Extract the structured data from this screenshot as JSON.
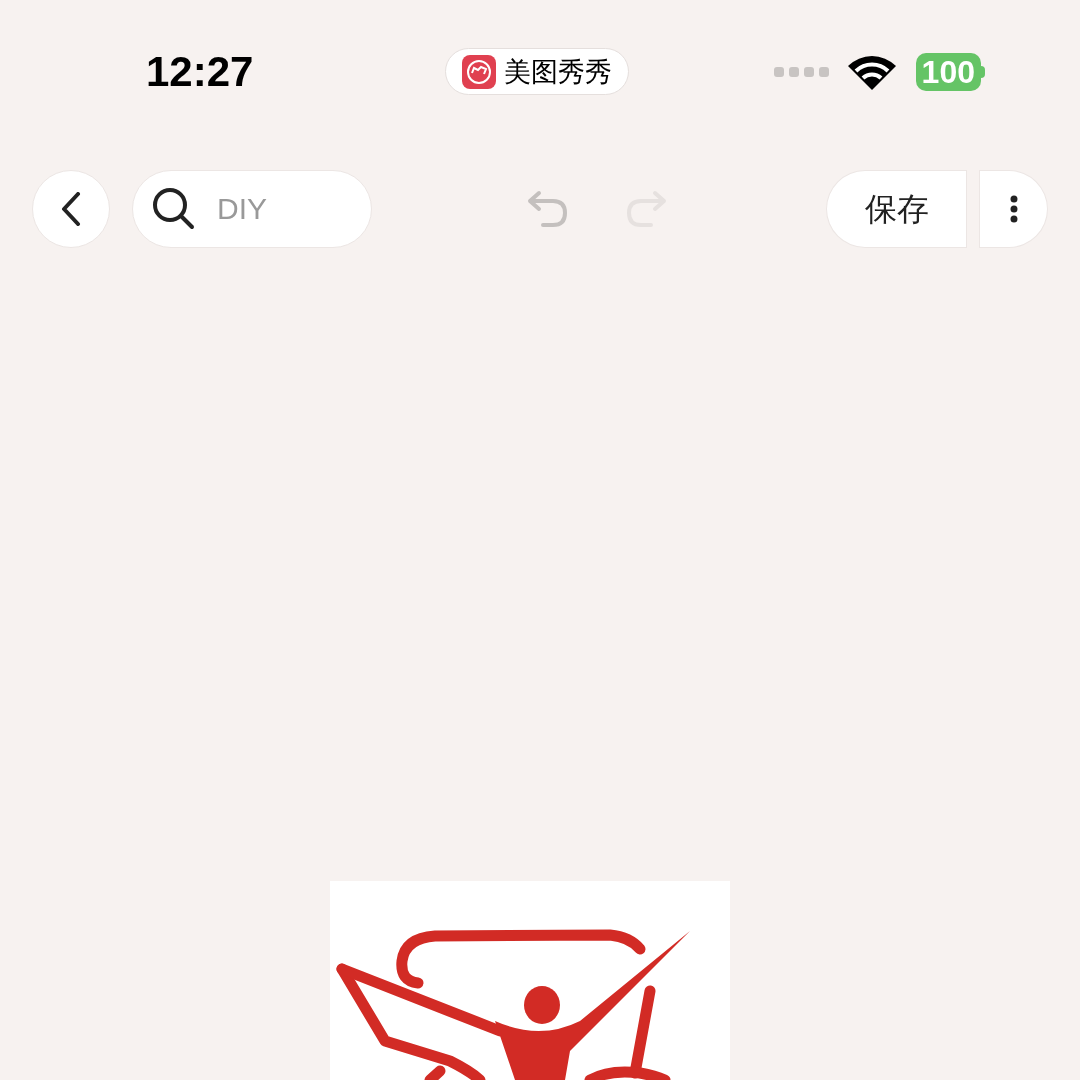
{
  "status_bar": {
    "time": "12:27",
    "app_badge": "美图秀秀",
    "battery": "100"
  },
  "toolbar": {
    "search": {
      "placeholder": "DIY"
    },
    "history": [
      {
        "kind": "undo",
        "disabled": false
      },
      {
        "kind": "redo",
        "disabled": true
      }
    ],
    "save": "保存"
  }
}
